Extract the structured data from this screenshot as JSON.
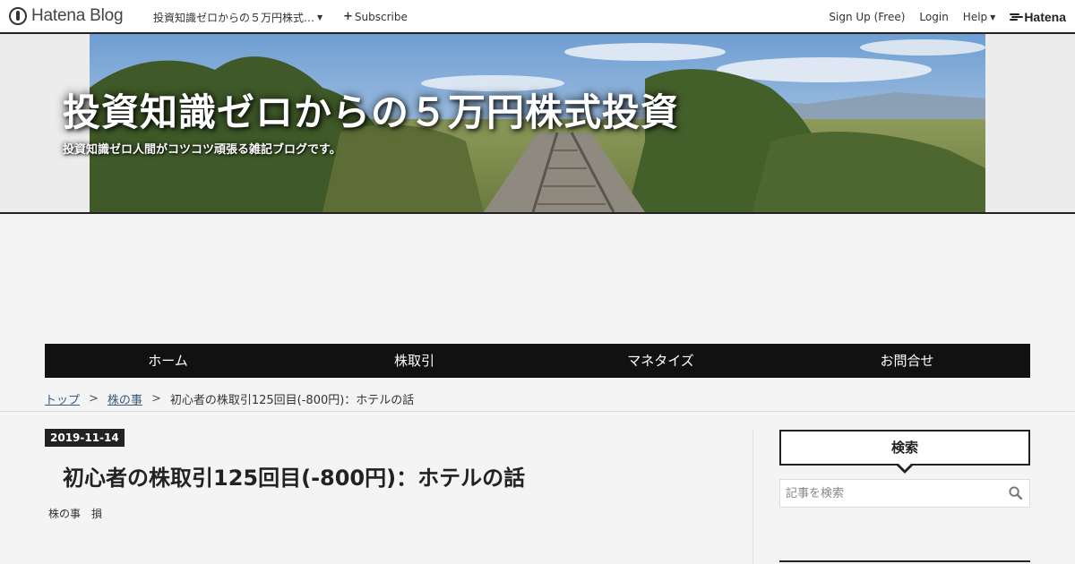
{
  "topbar": {
    "logo_text": "Hatena Blog",
    "blog_name": "投資知識ゼロからの５万円株式…",
    "subscribe_label": "Subscribe",
    "signup_label": "Sign Up (Free)",
    "login_label": "Login",
    "help_label": "Help",
    "hatena_label": "Hatena"
  },
  "header": {
    "title": "投資知識ゼロからの５万円株式投資",
    "description": "投資知識ゼロ人間がコツコツ頑張る雑記ブログです。"
  },
  "nav": {
    "items": [
      {
        "label": "ホーム"
      },
      {
        "label": "株取引"
      },
      {
        "label": "マネタイズ"
      },
      {
        "label": "お問合せ"
      }
    ]
  },
  "breadcrumb": {
    "top": "トップ",
    "sep": ">",
    "category": "株の事",
    "current": "初心者の株取引125回目(-800円)：ホテルの話"
  },
  "entry": {
    "date": "2019-11-14",
    "title": "初心者の株取引125回目(-800円)：ホテルの話",
    "categories": [
      "株の事",
      "損"
    ]
  },
  "sidebar": {
    "search_title": "検索",
    "search_placeholder": "記事を検索"
  },
  "icons": {
    "logo": "hatena-blog-logo-icon",
    "search": "search-icon",
    "hatena": "hatena-mark-icon"
  }
}
